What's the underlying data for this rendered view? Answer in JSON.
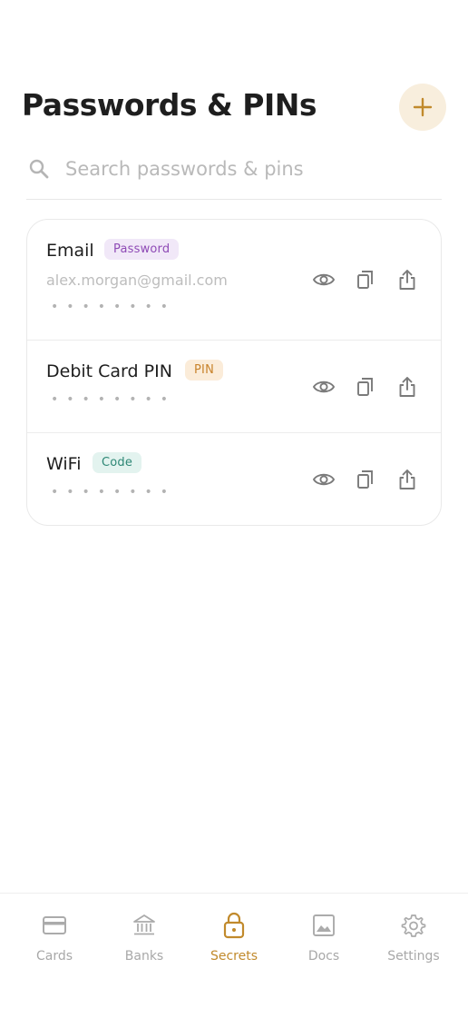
{
  "header": {
    "title": "Passwords & PINs",
    "add_icon": "plus-icon"
  },
  "search": {
    "placeholder": "Search passwords & pins",
    "value": "",
    "icon": "search-icon"
  },
  "items": [
    {
      "name": "Email",
      "badge": "Password",
      "subtitle": "alex.morgan@gmail.com",
      "masked": "••••••••"
    },
    {
      "name": "Debit Card PIN",
      "badge": "PIN",
      "masked": "••••••••"
    },
    {
      "name": "WiFi",
      "badge": "Code",
      "masked": "••••••••"
    }
  ],
  "nav": {
    "items": [
      {
        "label": "Cards",
        "icon": "card-icon"
      },
      {
        "label": "Banks",
        "icon": "bank-icon"
      },
      {
        "label": "Secrets",
        "icon": "lock-icon",
        "active": true
      },
      {
        "label": "Docs",
        "icon": "image-icon"
      },
      {
        "label": "Settings",
        "icon": "gear-icon"
      }
    ]
  },
  "colors": {
    "accent": "#c18a2c",
    "accent_bg": "#f8eedd",
    "badge_password": "#8f4bb6",
    "badge_pin": "#c8832c",
    "badge_code": "#2d8775"
  }
}
